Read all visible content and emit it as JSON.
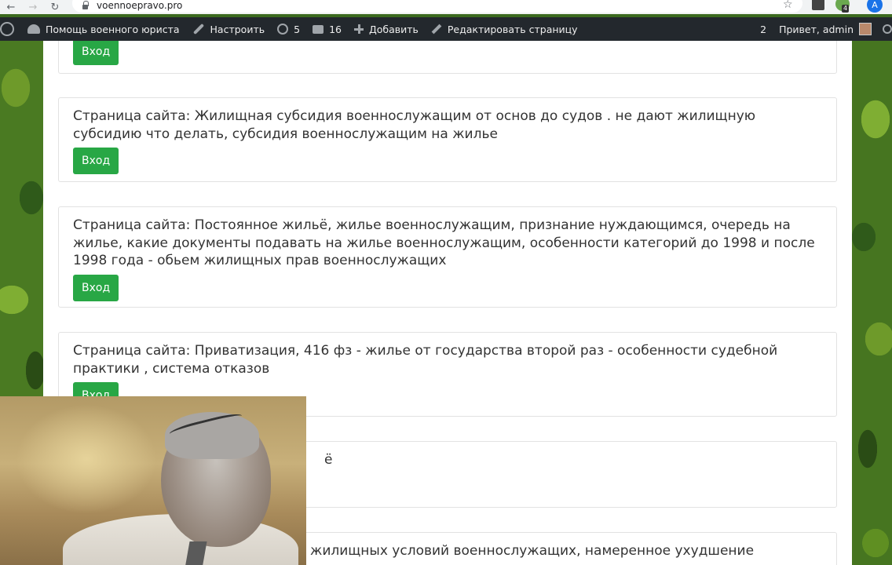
{
  "browser": {
    "url": "voennoepravo.pro",
    "profile_initial": "A",
    "extension_badge": "4"
  },
  "admin_bar": {
    "site_name": "Помощь военного юриста",
    "customize": "Настроить",
    "updates_count": "5",
    "comments_count": "16",
    "add_new": "Добавить",
    "edit_page": "Редактировать страницу",
    "notifications_count": "2",
    "greeting": "Привет, admin"
  },
  "cards": [
    {
      "text": "",
      "button": "Вход"
    },
    {
      "text": "Страница сайта: Жилищная субсидия военнослужащим от основ до судов . не дают жилищную субсидию что делать, субсидия военнослужащим на жилье",
      "button": "Вход"
    },
    {
      "text": "Страница сайта: Постоянное жильё, жилье военнослужащим, признание нуждающимся, очередь на жилье, какие документы подавать на жилье военнослужащим, особенности категорий до 1998 и после 1998 года - обьем жилищных прав военнослужащих",
      "button": "Вход"
    },
    {
      "text": "Страница сайта: Приватизация, 416 фз - жилье от государства второй раз - особенности судебной практики , система отказов",
      "button": "Вход"
    },
    {
      "text": "ё",
      "button": ""
    },
    {
      "text": "жилищных условий военнослужащих, намеренное ухудшение",
      "button": ""
    }
  ],
  "colors": {
    "button_green": "#28a745",
    "admin_bar_bg": "#23282d"
  }
}
